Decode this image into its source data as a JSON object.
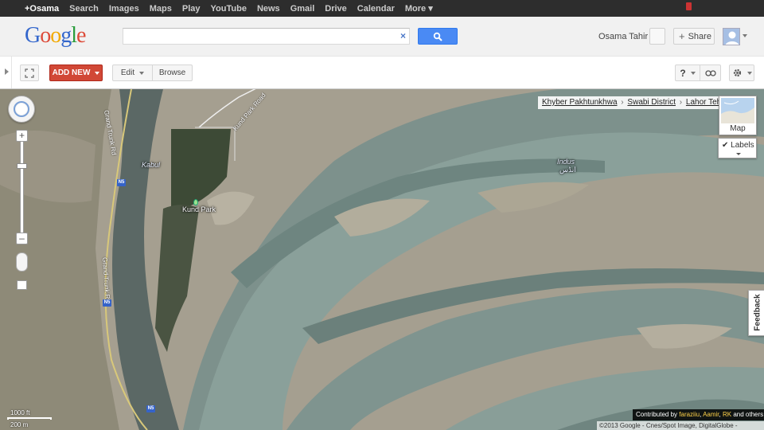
{
  "topbar": {
    "links": [
      "+Osama",
      "Search",
      "Images",
      "Maps",
      "Play",
      "YouTube",
      "News",
      "Gmail",
      "Drive",
      "Calendar",
      "More ▾"
    ]
  },
  "header": {
    "logo_letters": [
      "G",
      "o",
      "o",
      "g",
      "l",
      "e"
    ],
    "logo_colors": [
      "#3366cc",
      "#dd4b39",
      "#f2a900",
      "#3366cc",
      "#2a9d3c",
      "#dd4b39"
    ],
    "search": {
      "value": "",
      "placeholder": ""
    },
    "clear_glyph": "×",
    "username": "Osama Tahir",
    "share_label": "Share"
  },
  "toolbar": {
    "add_new_label": "ADD NEW",
    "edit_label": "Edit",
    "browse_label": "Browse",
    "help_label": "?",
    "accent_red": "#d14836"
  },
  "map": {
    "breadcrumb": [
      "Khyber Pakhtunkhwa",
      "Swabi District",
      "Lahor Tehsil"
    ],
    "breadcrumb_sep": "›",
    "map_type_label": "Map",
    "labels_label": "Labels",
    "labels_checked": true,
    "feedback_label": "Feedback",
    "scale": {
      "top": "1000 ft",
      "bottom": "200 m"
    },
    "contributed": {
      "prefix": "Contributed by ",
      "names": [
        "faraziiu",
        "Aamir",
        "RK"
      ],
      "suffix": " and others"
    },
    "copyright": "©2013 Google - Cnes/Spot Image, DigitalGlobe -",
    "place_labels": {
      "kabul": "Kabul",
      "kund_park": "Kund Park",
      "indus": "Indus",
      "indus_urdu": "انڈس",
      "road_gt": "Grand Trunk Rd",
      "road_kund": "Kund Park Road",
      "road_n5": "N5"
    }
  }
}
